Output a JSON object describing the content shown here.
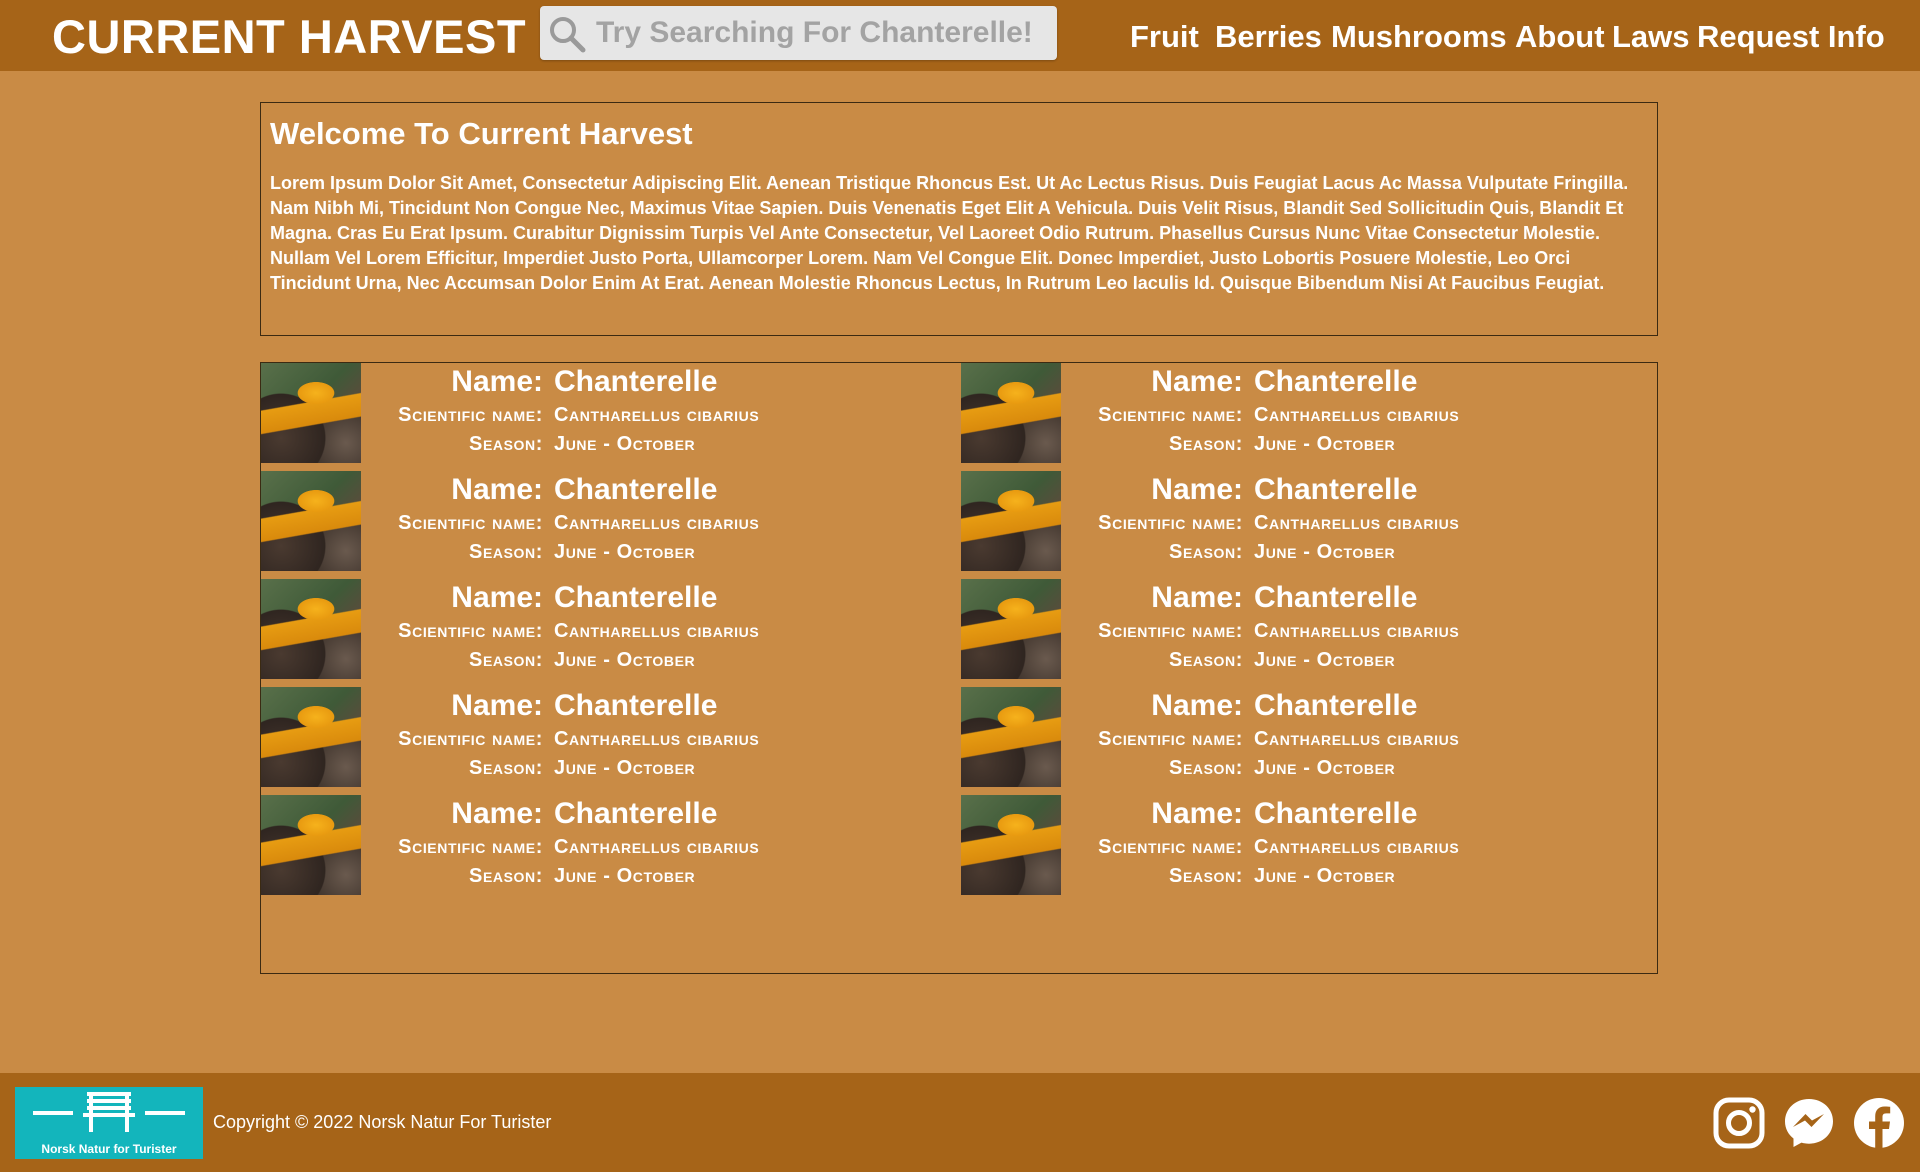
{
  "header": {
    "brand": "CURRENT HARVEST",
    "search": {
      "placeholder": "Try Searching For Chanterelle!",
      "value": ""
    },
    "nav": [
      {
        "label": "Fruit"
      },
      {
        "label": "Berries"
      },
      {
        "label": "Mushrooms"
      },
      {
        "label": "About"
      },
      {
        "label": "Laws"
      },
      {
        "label": "Request Info"
      }
    ]
  },
  "welcome": {
    "title": "Welcome To Current Harvest",
    "body": "Lorem Ipsum Dolor Sit Amet, Consectetur Adipiscing Elit. Aenean Tristique Rhoncus Est. Ut Ac Lectus Risus. Duis Feugiat Lacus Ac Massa Vulputate Fringilla. Nam Nibh Mi, Tincidunt Non Congue Nec, Maximus Vitae Sapien. Duis Venenatis Eget Elit A Vehicula. Duis Velit Risus, Blandit Sed Sollicitudin Quis, Blandit Et Magna. Cras Eu Erat Ipsum. Curabitur Dignissim Turpis Vel Ante Consectetur, Vel Laoreet Odio Rutrum. Phasellus Cursus Nunc Vitae Consectetur Molestie. Nullam Vel Lorem Efficitur, Imperdiet Justo Porta, Ullamcorper Lorem. Nam Vel Congue Elit. Donec Imperdiet, Justo Lobortis Posuere Molestie, Leo Orci Tincidunt Urna, Nec Accumsan Dolor Enim At Erat. Aenean Molestie Rhoncus Lectus, In Rutrum Leo Iaculis Id. Quisque Bibendum Nisi At Faucibus Feugiat."
  },
  "labels": {
    "name": "Name:",
    "scientific": "Scientific name:",
    "season": "Season:"
  },
  "cards": [
    {
      "name": "Chanterelle",
      "scientific": "Cantharellus cibarius",
      "season": "June - October"
    },
    {
      "name": "Chanterelle",
      "scientific": "Cantharellus cibarius",
      "season": "June - October"
    },
    {
      "name": "Chanterelle",
      "scientific": "Cantharellus cibarius",
      "season": "June - October"
    },
    {
      "name": "Chanterelle",
      "scientific": "Cantharellus cibarius",
      "season": "June - October"
    },
    {
      "name": "Chanterelle",
      "scientific": "Cantharellus cibarius",
      "season": "June - October"
    },
    {
      "name": "Chanterelle",
      "scientific": "Cantharellus cibarius",
      "season": "June - October"
    },
    {
      "name": "Chanterelle",
      "scientific": "Cantharellus cibarius",
      "season": "June - October"
    },
    {
      "name": "Chanterelle",
      "scientific": "Cantharellus cibarius",
      "season": "June - October"
    },
    {
      "name": "Chanterelle",
      "scientific": "Cantharellus cibarius",
      "season": "June - October"
    },
    {
      "name": "Chanterelle",
      "scientific": "Cantharellus cibarius",
      "season": "June - October"
    }
  ],
  "footer": {
    "logo_text": "Norsk Natur for Turister",
    "copyright": "Copyright © 2022 Norsk Natur For Turister",
    "social": [
      {
        "icon": "instagram-icon"
      },
      {
        "icon": "messenger-icon"
      },
      {
        "icon": "facebook-icon"
      }
    ]
  },
  "colors": {
    "header_bg": "#a66418",
    "page_bg": "#c98b45",
    "footer_logo_bg": "#13b5bc",
    "search_bg": "#e6e6e6"
  }
}
